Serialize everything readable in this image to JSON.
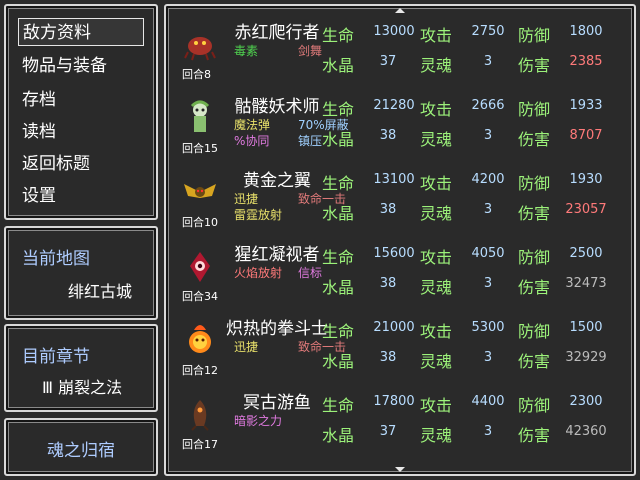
{
  "menu": {
    "items": [
      {
        "label": "敌方资料",
        "selected": true
      },
      {
        "label": "物品与装备"
      },
      {
        "label": "存档"
      },
      {
        "label": "读档"
      },
      {
        "label": "返回标题"
      },
      {
        "label": "设置"
      }
    ]
  },
  "map": {
    "title": "当前地图",
    "value": "绯红古城"
  },
  "chapter": {
    "title": "目前章节",
    "value": "Ⅲ  崩裂之法"
  },
  "home": {
    "label": "魂之归宿"
  },
  "stat_labels": {
    "hp": "生命",
    "atk": "攻击",
    "def": "防御",
    "crystal": "水晶",
    "soul": "灵魂",
    "damage": "伤害"
  },
  "colors": {
    "label_green": "#9cf27a",
    "value_blue": "#b8ddff",
    "damage_red": "#ff7a7a",
    "damage_gray": "#bbbbbb",
    "panel_border": "#d8d8d8",
    "menu_title_blue": "#aeccff"
  },
  "enemies": [
    {
      "name": "赤红爬行者",
      "sprite": "crimson-crawler-sprite",
      "abilities": [
        {
          "text": "毒素",
          "color": "#4fd34f"
        },
        {
          "text": "剑舞",
          "color": "#e07a7a"
        }
      ],
      "abilities2": [],
      "turns": "回合8",
      "hp": "13000",
      "atk": "2750",
      "def": "1800",
      "crystal": "37",
      "soul": "3",
      "damage": "2385",
      "damage_color": "#ff7a7a"
    },
    {
      "name": "骷髅妖术师",
      "sprite": "skeleton-sorcerer-sprite",
      "abilities": [
        {
          "text": "魔法弹",
          "color": "#e8e06a"
        },
        {
          "text": "70%屏蔽",
          "color": "#a0d0ff"
        }
      ],
      "abilities2": [
        {
          "text": "%协同",
          "color": "#e07ae0"
        },
        {
          "text": "镇压",
          "color": "#a0d0ff"
        }
      ],
      "turns": "回合15",
      "hp": "21280",
      "atk": "2666",
      "def": "1933",
      "crystal": "38",
      "soul": "3",
      "damage": "8707",
      "damage_color": "#ff7a7a"
    },
    {
      "name": "黄金之翼",
      "sprite": "golden-wing-sprite",
      "abilities": [
        {
          "text": "迅捷",
          "color": "#e8e06a"
        },
        {
          "text": "致命一击",
          "color": "#e07a7a"
        }
      ],
      "abilities2": [
        {
          "text": "雷霆放射",
          "color": "#e8e06a"
        }
      ],
      "turns": "回合10",
      "hp": "13100",
      "atk": "4200",
      "def": "1930",
      "crystal": "38",
      "soul": "3",
      "damage": "23057",
      "damage_color": "#ff7a7a"
    },
    {
      "name": "猩红凝视者",
      "sprite": "scarlet-gazer-sprite",
      "abilities": [
        {
          "text": "火焰放射",
          "color": "#ff7a7a"
        },
        {
          "text": "信标",
          "color": "#e07ae0"
        }
      ],
      "abilities2": [],
      "turns": "回合34",
      "hp": "15600",
      "atk": "4050",
      "def": "2500",
      "crystal": "38",
      "soul": "3",
      "damage": "32473",
      "damage_color": "#bbbbbb"
    },
    {
      "name": "炽热的拳斗士",
      "sprite": "blazing-brawler-sprite",
      "abilities": [
        {
          "text": "迅捷",
          "color": "#e8e06a"
        },
        {
          "text": "致命一击",
          "color": "#e07a7a"
        }
      ],
      "abilities2": [],
      "turns": "回合12",
      "hp": "21000",
      "atk": "5300",
      "def": "1500",
      "crystal": "38",
      "soul": "3",
      "damage": "32929",
      "damage_color": "#bbbbbb"
    },
    {
      "name": "冥古游鱼",
      "sprite": "ancient-fish-sprite",
      "abilities": [
        {
          "text": "暗影之力",
          "color": "#e07ae0"
        }
      ],
      "abilities2": [],
      "turns": "回合17",
      "hp": "17800",
      "atk": "4400",
      "def": "2300",
      "crystal": "37",
      "soul": "3",
      "damage": "42360",
      "damage_color": "#bbbbbb"
    }
  ]
}
